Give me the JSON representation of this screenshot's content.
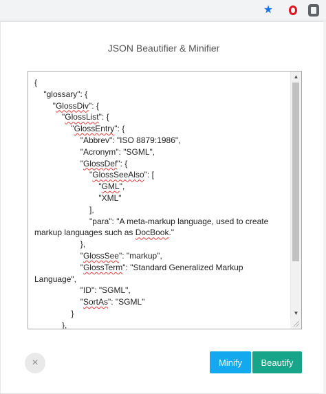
{
  "app": {
    "title": "JSON Beautifier & Minifier"
  },
  "browser": {
    "icons": [
      "star-icon",
      "opera-icon",
      "extension-icon"
    ],
    "colors": {
      "star": "#1a73e8",
      "opera": "#e0141e"
    }
  },
  "editor": {
    "lines": [
      "{",
      "    \"glossary\": {",
      "        \"GlossDiv\": {",
      "            \"GlossList\": {",
      "                \"GlossEntry\": {",
      "                    \"Abbrev\": \"ISO 8879:1986\",",
      "                    \"Acronym\": \"SGML\",",
      "                    \"GlossDef\": {",
      "                        \"GlossSeeAlso\": [",
      "                            \"GML\",",
      "                            \"XML\"",
      "                        ],",
      "                        \"para\": \"A meta-markup language, used to create",
      "markup languages such as DocBook.\"",
      "                    },",
      "                    \"GlossSee\": \"markup\",",
      "                    \"GlossTerm\": \"Standard Generalized Markup",
      "Language\",",
      "                    \"ID\": \"SGML\",",
      "                    \"SortAs\": \"SGML\"",
      "                }",
      "            },",
      "        }"
    ]
  },
  "actions": {
    "close_icon": "×",
    "minify_label": "Minify",
    "beautify_label": "Beautify"
  },
  "colors": {
    "minify": "#12a9ef",
    "beautify": "#17a589"
  }
}
